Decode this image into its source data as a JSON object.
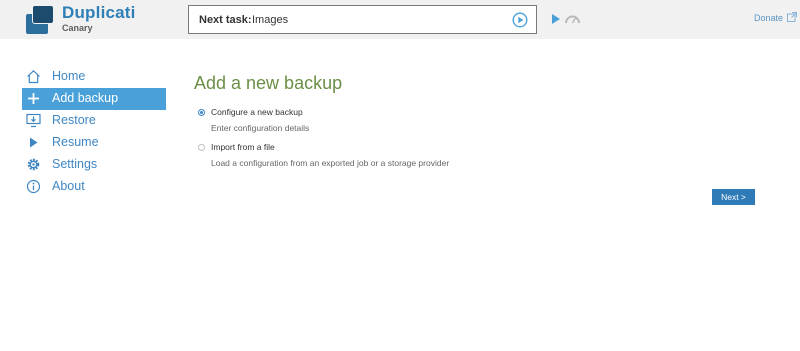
{
  "brand": {
    "name": "Duplicati",
    "subtitle": "Canary"
  },
  "header": {
    "next_task_label": "Next task:",
    "next_task_value": "Images",
    "donate_label": "Donate"
  },
  "sidebar": {
    "items": [
      {
        "label": "Home",
        "icon": "home-icon",
        "active": false
      },
      {
        "label": "Add backup",
        "icon": "plus-icon",
        "active": true
      },
      {
        "label": "Restore",
        "icon": "restore-icon",
        "active": false
      },
      {
        "label": "Resume",
        "icon": "play-icon",
        "active": false
      },
      {
        "label": "Settings",
        "icon": "gear-icon",
        "active": false
      },
      {
        "label": "About",
        "icon": "info-icon",
        "active": false
      }
    ]
  },
  "main": {
    "title": "Add a new backup",
    "options": [
      {
        "title": "Configure a new backup",
        "description": "Enter configuration details",
        "selected": true
      },
      {
        "title": "Import from a file",
        "description": "Load a configuration from an exported job or a storage provider",
        "selected": false
      }
    ],
    "next_label": "Next >"
  },
  "colors": {
    "accent": "#4aa0d8",
    "link": "#3f87c4",
    "title_green": "#6b8f47",
    "button": "#2f7bb8",
    "topbar_bg": "#f1f1f1"
  }
}
